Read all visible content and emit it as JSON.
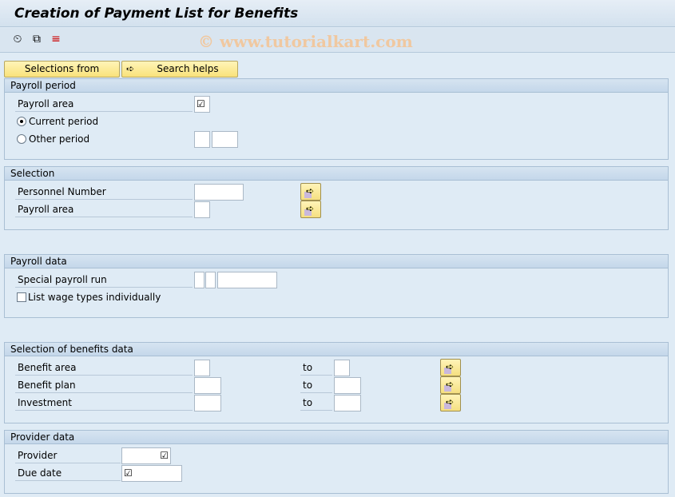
{
  "title": "Creation of Payment List for Benefits",
  "watermark": "© www.tutorialkart.com",
  "toolbar": {
    "icons": [
      "execute-icon",
      "get-variant-icon",
      "selection-options-icon"
    ]
  },
  "buttons": {
    "selections_from": "Selections from",
    "search_helps": "Search helps"
  },
  "payroll_period": {
    "header": "Payroll period",
    "payroll_area": "Payroll area",
    "payroll_area_value": "☑",
    "current_period": "Current period",
    "other_period": "Other period",
    "selected": "current_period"
  },
  "selection": {
    "header": "Selection",
    "personnel_number": "Personnel Number",
    "payroll_area": "Payroll area"
  },
  "payroll_data": {
    "header": "Payroll data",
    "special_payroll_run": "Special payroll run",
    "list_wage_types": "List wage types individually",
    "list_wage_types_checked": false
  },
  "benefits": {
    "header": "Selection of benefits data",
    "to": "to",
    "rows": [
      "Benefit area",
      "Benefit plan",
      "Investment"
    ]
  },
  "provider": {
    "header": "Provider data",
    "provider": "Provider",
    "due_date": "Due date",
    "check": "☑"
  },
  "colors": {
    "button_yellow": "#f9e27a",
    "background": "#dfebf5",
    "watermark": "#f0c8a0"
  }
}
